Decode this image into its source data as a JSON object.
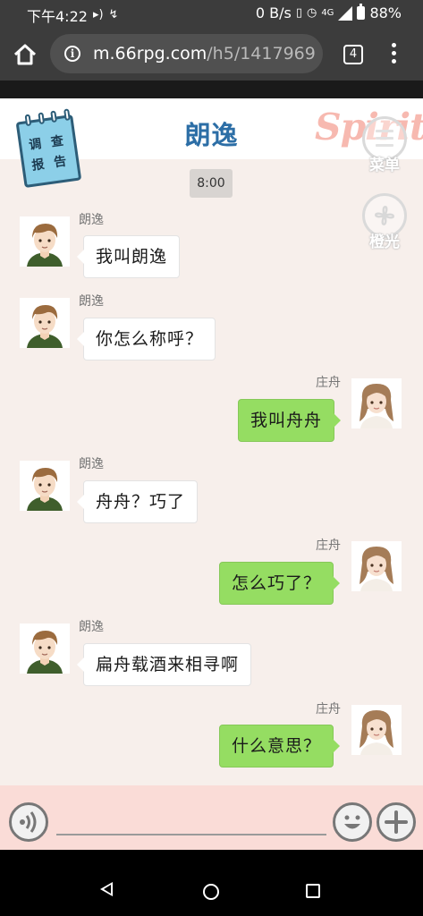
{
  "status_bar": {
    "time": "下午4:22",
    "net_speed": "0 B/s",
    "network": "4G",
    "battery": "88%",
    "icons": [
      "volume-icon",
      "missed-call-icon",
      "alarm-icon",
      "vibrate-icon",
      "signal-icon",
      "battery-icon"
    ]
  },
  "browser": {
    "url_domain": "m.66rpg.com",
    "url_path": "/h5/1417969",
    "tab_count": "4",
    "icons": [
      "home-icon",
      "info-icon",
      "more-vert-icon"
    ]
  },
  "game": {
    "chat_title": "朗逸",
    "report_label_1": "调 查",
    "report_label_2": "报 告",
    "logo_text": "Spirit",
    "menu_label": "菜单",
    "skip_label": "橙光",
    "time_label": "8:00",
    "colors": {
      "title": "#2c6ea6",
      "outgoing_bubble": "#95dd62",
      "incoming_bubble": "#ffffff",
      "background": "#f7efeb",
      "input_bar": "#fadcd7"
    }
  },
  "messages": [
    {
      "sender": "朗逸",
      "side": "left",
      "text": "我叫朗逸"
    },
    {
      "sender": "朗逸",
      "side": "left",
      "text": "你怎么称呼？"
    },
    {
      "sender": "庄舟",
      "side": "right",
      "text": "我叫舟舟"
    },
    {
      "sender": "朗逸",
      "side": "left",
      "text": "舟舟？巧了"
    },
    {
      "sender": "庄舟",
      "side": "right",
      "text": "怎么巧了？"
    },
    {
      "sender": "朗逸",
      "side": "left",
      "text": "扁舟载酒来相寻啊"
    },
    {
      "sender": "庄舟",
      "side": "right",
      "text": "什么意思？"
    }
  ],
  "input": {
    "value": "",
    "icons": [
      "voice-icon",
      "emoji-icon",
      "plus-icon"
    ]
  },
  "nav": {
    "icons": [
      "back-icon",
      "home-circle-icon",
      "recents-icon"
    ]
  }
}
